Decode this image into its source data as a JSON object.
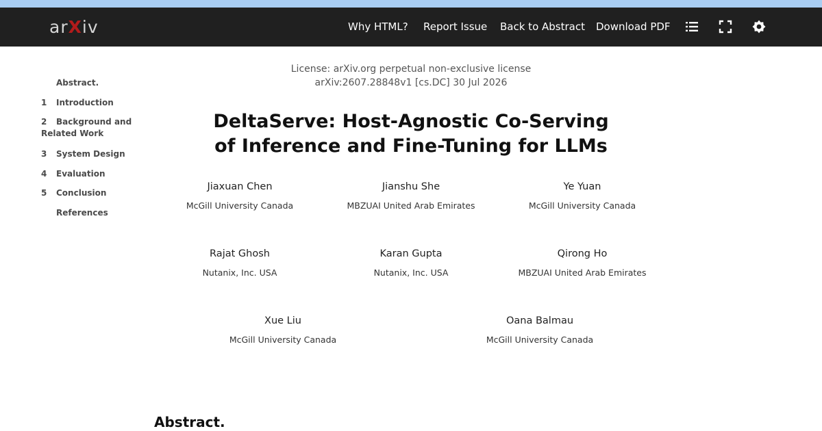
{
  "nav": {
    "logo_prefix": "ar",
    "logo_x": "X",
    "logo_suffix": "iv",
    "links": [
      "Why HTML?",
      "Report Issue",
      "Back to Abstract",
      "Download PDF"
    ],
    "icons": [
      "list-icon",
      "fullscreen-icon",
      "settings-icon"
    ]
  },
  "toc": [
    {
      "num": "",
      "label": "Abstract."
    },
    {
      "num": "1",
      "label": "Introduction"
    },
    {
      "num": "2",
      "label": "Background and Related Work"
    },
    {
      "num": "3",
      "label": "System Design"
    },
    {
      "num": "4",
      "label": "Evaluation"
    },
    {
      "num": "5",
      "label": "Conclusion"
    },
    {
      "num": "",
      "label": "References"
    }
  ],
  "paper": {
    "license": "License: arXiv.org perpetual non-exclusive license",
    "arxiv_id": "arXiv:2607.28848v1 [cs.DC] 30 Jul 2026",
    "title_line1": "DeltaServe: Host-Agnostic Co-Serving",
    "title_line2": "of Inference and Fine-Tuning for LLMs",
    "authors": [
      {
        "name": "Jiaxuan Chen",
        "affiliation": "McGill University  Canada"
      },
      {
        "name": "Jianshu She",
        "affiliation": "MBZUAI  United Arab Emirates"
      },
      {
        "name": "Ye Yuan",
        "affiliation": "McGill University  Canada"
      },
      {
        "name": "Rajat Ghosh",
        "affiliation": "Nutanix, Inc.  USA"
      },
      {
        "name": "Karan Gupta",
        "affiliation": "Nutanix, Inc.  USA"
      },
      {
        "name": "Qirong Ho",
        "affiliation": "MBZUAI  United Arab Emirates"
      },
      {
        "name": "Xue Liu",
        "affiliation": "McGill University  Canada"
      },
      {
        "name": "Oana Balmau",
        "affiliation": "McGill University  Canada"
      }
    ],
    "abstract_heading": "Abstract."
  }
}
